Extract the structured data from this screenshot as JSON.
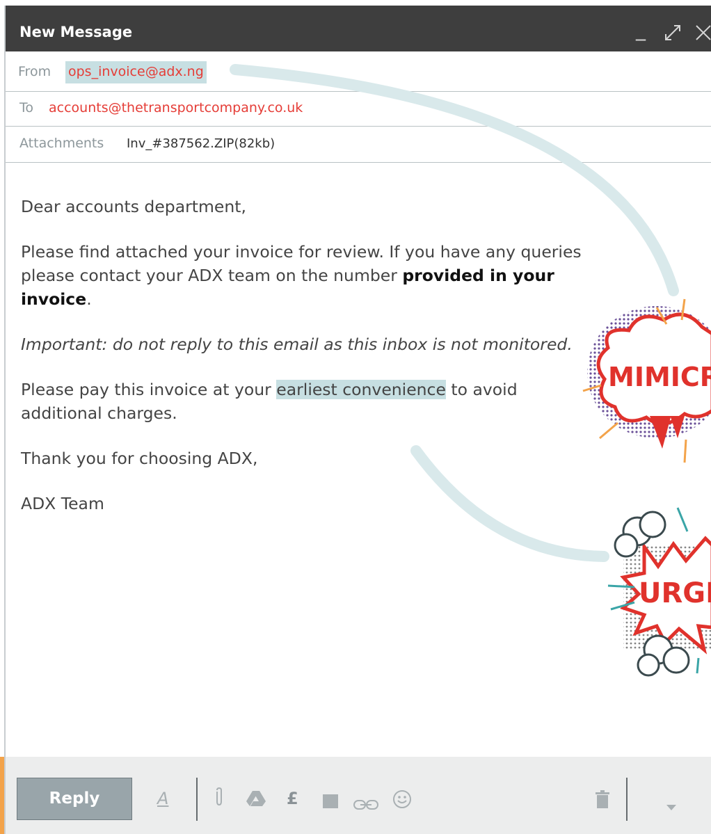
{
  "window": {
    "title": "New Message"
  },
  "header": {
    "from_label": "From",
    "from_value": "ops_invoice@adx.ng",
    "to_label": "To",
    "to_value": "accounts@thetransportcompany.co.uk",
    "attachments_label": "Attachments",
    "attachments_value": "Inv_#387562.ZIP(82kb)"
  },
  "body": {
    "greeting": "Dear accounts department,",
    "p1_start": "Please find attached your invoice for review. If you have any queries please contact your ADX team on the number ",
    "p1_bold": "provided in your invoice",
    "p1_end": ".",
    "p2_italic": "Important: do not reply to this email as this inbox is not monitored.",
    "p3_start": "Please pay this invoice at your ",
    "p3_highlight": "earliest convenience",
    "p3_end": " to avoid additional charges.",
    "closing": "Thank you for choosing ADX,",
    "signature": "ADX Team"
  },
  "stickers": {
    "mimicry": "MIMICR",
    "urgency": "URGE"
  },
  "toolbar": {
    "reply_label": "Reply"
  },
  "colors": {
    "titlebar": "#3e3e3e",
    "address_red": "#e53d37",
    "highlight": "#c7dfe2",
    "reply_button": "#99a5aa",
    "toolbar_bg": "#eceded",
    "accent_orange": "#f3a34a"
  },
  "icons": [
    "minimize-icon",
    "expand-icon",
    "close-icon",
    "format-text-icon",
    "attach-icon",
    "drive-icon",
    "pound-icon",
    "photo-icon",
    "link-icon",
    "emoji-icon",
    "trash-icon",
    "more-options-icon"
  ]
}
